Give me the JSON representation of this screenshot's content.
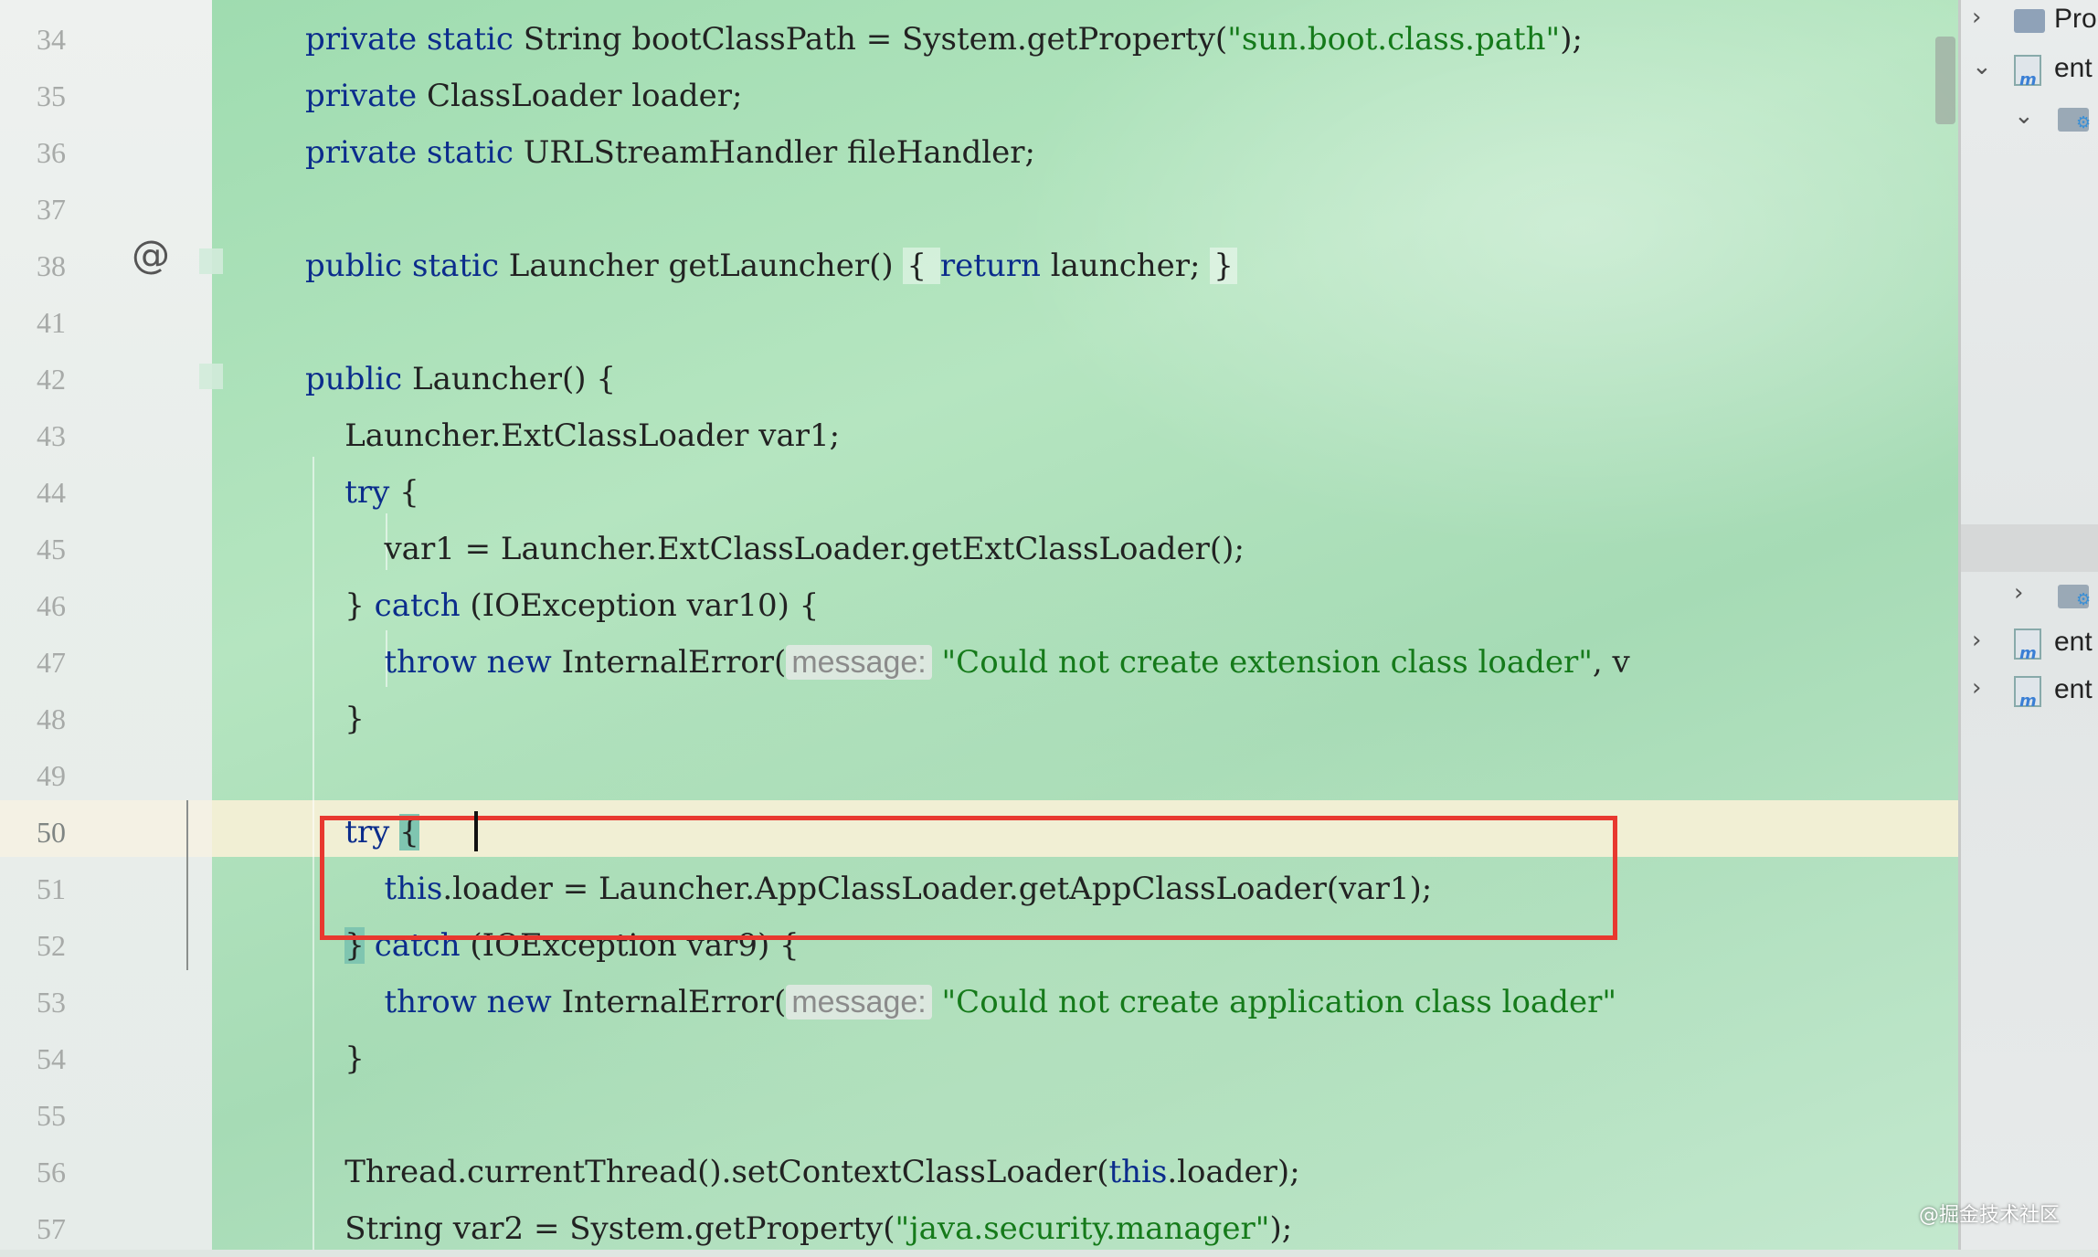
{
  "editor": {
    "lines": [
      {
        "num": "34",
        "segments": [
          {
            "t": "private static ",
            "c": "kw"
          },
          {
            "t": "String bootClassPath = System.getProperty(",
            "c": ""
          },
          {
            "t": "\"sun.boot.class.path\"",
            "c": "str"
          },
          {
            "t": ");",
            "c": ""
          }
        ]
      },
      {
        "num": "35",
        "segments": [
          {
            "t": "private ",
            "c": "kw"
          },
          {
            "t": "ClassLoader loader;",
            "c": ""
          }
        ]
      },
      {
        "num": "36",
        "segments": [
          {
            "t": "private static ",
            "c": "kw"
          },
          {
            "t": "URLStreamHandler fileHandler;",
            "c": ""
          }
        ]
      },
      {
        "num": "37",
        "segments": []
      },
      {
        "num": "38",
        "segments": [
          {
            "t": "public static ",
            "c": "kw"
          },
          {
            "t": "Launcher getLauncher() ",
            "c": ""
          },
          {
            "t": "{ ",
            "c": "box"
          },
          {
            "t": "return ",
            "c": "kw"
          },
          {
            "t": "launcher; ",
            "c": ""
          },
          {
            "t": "}",
            "c": "box"
          }
        ]
      },
      {
        "num": "41",
        "segments": []
      },
      {
        "num": "42",
        "segments": [
          {
            "t": "public ",
            "c": "kw"
          },
          {
            "t": "Launcher() {",
            "c": ""
          }
        ]
      },
      {
        "num": "43",
        "segments": [
          {
            "t": "    Launcher.ExtClassLoader var1;",
            "c": ""
          }
        ]
      },
      {
        "num": "44",
        "segments": [
          {
            "t": "    ",
            "c": ""
          },
          {
            "t": "try ",
            "c": "kw"
          },
          {
            "t": "{",
            "c": ""
          }
        ]
      },
      {
        "num": "45",
        "segments": [
          {
            "t": "        var1 = Launcher.ExtClassLoader.getExtClassLoader();",
            "c": ""
          }
        ]
      },
      {
        "num": "46",
        "segments": [
          {
            "t": "    } ",
            "c": ""
          },
          {
            "t": "catch ",
            "c": "kw"
          },
          {
            "t": "(IOException var10) {",
            "c": ""
          }
        ]
      },
      {
        "num": "47",
        "segments": [
          {
            "t": "        ",
            "c": ""
          },
          {
            "t": "throw new ",
            "c": "kw"
          },
          {
            "t": "InternalError(",
            "c": ""
          },
          {
            "t": "message:",
            "c": "hint"
          },
          {
            "t": " \"Could not create extension class loader\"",
            "c": "str"
          },
          {
            "t": ", v",
            "c": ""
          }
        ]
      },
      {
        "num": "48",
        "segments": [
          {
            "t": "    }",
            "c": ""
          }
        ]
      },
      {
        "num": "49",
        "segments": []
      },
      {
        "num": "50",
        "active": true,
        "segments": [
          {
            "t": "    ",
            "c": ""
          },
          {
            "t": "try ",
            "c": "kw"
          },
          {
            "t": "{",
            "c": "match"
          }
        ]
      },
      {
        "num": "51",
        "segments": [
          {
            "t": "        ",
            "c": ""
          },
          {
            "t": "this",
            "c": "kw"
          },
          {
            "t": ".loader = Launcher.AppClassLoader.getAppClassLoader(var1);",
            "c": ""
          }
        ]
      },
      {
        "num": "52",
        "segments": [
          {
            "t": "    ",
            "c": ""
          },
          {
            "t": "}",
            "c": "match"
          },
          {
            "t": " ",
            "c": ""
          },
          {
            "t": "catch ",
            "c": "kw"
          },
          {
            "t": "(IOException var9) {",
            "c": ""
          }
        ]
      },
      {
        "num": "53",
        "segments": [
          {
            "t": "        ",
            "c": ""
          },
          {
            "t": "throw new ",
            "c": "kw"
          },
          {
            "t": "InternalError(",
            "c": ""
          },
          {
            "t": "message:",
            "c": "hint"
          },
          {
            "t": " \"Could not create application class loader\"",
            "c": "str"
          }
        ]
      },
      {
        "num": "54",
        "segments": [
          {
            "t": "    }",
            "c": ""
          }
        ]
      },
      {
        "num": "55",
        "segments": []
      },
      {
        "num": "56",
        "segments": [
          {
            "t": "    Thread.currentThread().setContextClassLoader(",
            "c": ""
          },
          {
            "t": "this",
            "c": "kw"
          },
          {
            "t": ".loader);",
            "c": ""
          }
        ]
      },
      {
        "num": "57",
        "segments": [
          {
            "t": "    String var2 = System.getProperty(",
            "c": ""
          },
          {
            "t": "\"java.security.manager\"",
            "c": "str"
          },
          {
            "t": ");",
            "c": ""
          }
        ]
      }
    ]
  },
  "gutter": {
    "at_icon": "@"
  },
  "project_panel": {
    "rows": [
      {
        "chevron": "›",
        "icon": "folder-icon",
        "label": "Pro"
      },
      {
        "chevron": "⌄",
        "icon": "module-icon",
        "label": "ent"
      },
      {
        "chevron": "⌄",
        "icon": "folder-config-icon",
        "label": ""
      },
      {
        "chevron": "›",
        "icon": "folder-config-icon",
        "label": ""
      },
      {
        "chevron": "›",
        "icon": "module-icon",
        "label": "ent"
      },
      {
        "chevron": "›",
        "icon": "module-icon",
        "label": "ent"
      }
    ]
  },
  "watermark": "@掘金技术社区",
  "colors": {
    "keyword": "#0b2c8c",
    "string": "#157a1a",
    "highlight_box": "#e8382f"
  }
}
